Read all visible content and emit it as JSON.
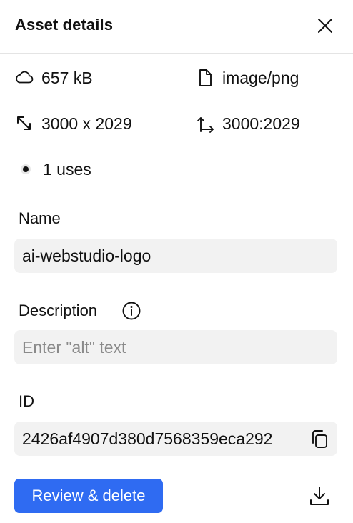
{
  "panel": {
    "title": "Asset details",
    "close_icon": "close-icon"
  },
  "meta": {
    "size": {
      "icon": "cloud-icon",
      "value": "657 kB"
    },
    "type": {
      "icon": "file-icon",
      "value": "image/png"
    },
    "dimensions": {
      "icon": "resize-diagonal-icon",
      "value": "3000 x 2029"
    },
    "aspect_ratio": {
      "icon": "aspect-ratio-icon",
      "value": "3000:2029"
    },
    "uses": {
      "icon": "usage-dot-icon",
      "value": "1 uses"
    }
  },
  "name_field": {
    "label": "Name",
    "value": "ai-webstudio-logo"
  },
  "description_field": {
    "label": "Description",
    "placeholder": "Enter \"alt\" text",
    "info_icon": "info-icon"
  },
  "id_field": {
    "label": "ID",
    "value": "2426af4907d380d7568359eca292",
    "copy_icon": "copy-icon"
  },
  "actions": {
    "review_delete_label": "Review & delete",
    "download_icon": "download-icon"
  },
  "colors": {
    "primary": "#2f6bf2",
    "field_bg": "#f2f2f2",
    "divider": "#e4e4e4",
    "placeholder_text": "#8a8a8a"
  }
}
